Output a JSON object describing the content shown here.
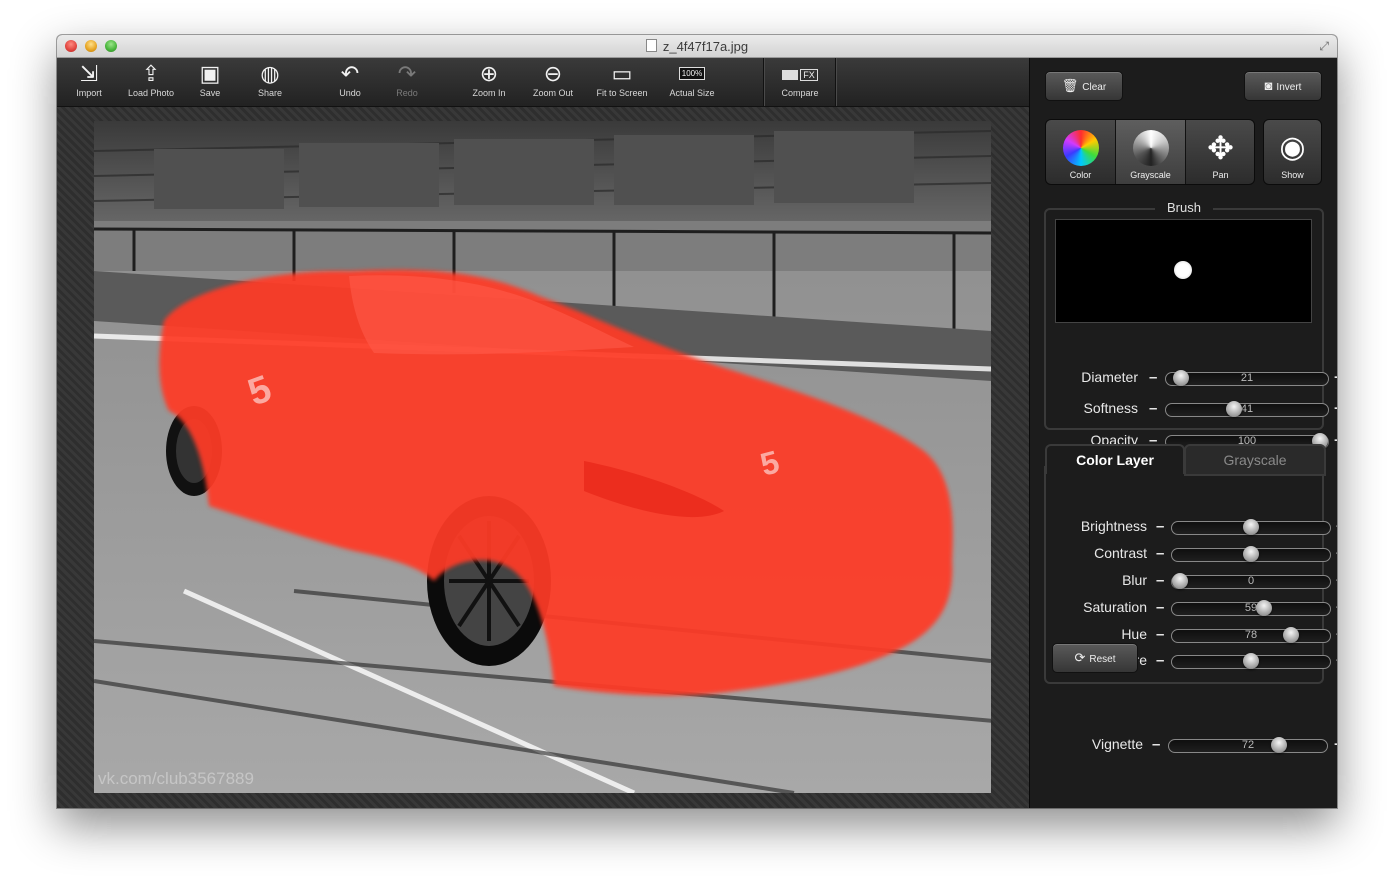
{
  "window": {
    "title": "z_4f47f17a.jpg"
  },
  "toolbar": {
    "import": "Import",
    "load_photo": "Load Photo",
    "save": "Save",
    "share": "Share",
    "undo": "Undo",
    "redo": "Redo",
    "zoom_in": "Zoom In",
    "zoom_out": "Zoom Out",
    "fit_to_screen": "Fit to Screen",
    "actual_size": "Actual Size",
    "actual_size_badge": "100%",
    "compare": "Compare",
    "compare_badge": "FX"
  },
  "canvas": {
    "watermark": "vk.com/club3567889"
  },
  "sidebar": {
    "clear": "Clear",
    "invert": "Invert",
    "modes": {
      "color": "Color",
      "grayscale": "Grayscale",
      "pan": "Pan",
      "show": "Show"
    },
    "brush": {
      "title": "Brush",
      "diameter": {
        "label": "Diameter",
        "value": 21,
        "fraction": 0.05
      },
      "softness": {
        "label": "Softness",
        "value": 41,
        "fraction": 0.41
      },
      "opacity": {
        "label": "Opacity",
        "value": 100,
        "fraction": 1.0
      }
    },
    "tabs": {
      "color_layer": "Color Layer",
      "grayscale": "Grayscale"
    },
    "adjust": {
      "brightness": {
        "label": "Brightness",
        "value": 50,
        "fraction": 0.5
      },
      "contrast": {
        "label": "Contrast",
        "value": 50,
        "fraction": 0.5
      },
      "blur": {
        "label": "Blur",
        "value": 0,
        "fraction": 0.0
      },
      "saturation": {
        "label": "Saturation",
        "value": 59,
        "fraction": 0.59
      },
      "hue": {
        "label": "Hue",
        "value": 78,
        "fraction": 0.78
      },
      "exposure": {
        "label": "Exposure",
        "value": 50,
        "fraction": 0.5
      }
    },
    "reset": "Reset",
    "vignette": {
      "label": "Vignette",
      "value": 72,
      "fraction": 0.72
    },
    "minus": "–",
    "plus": "+"
  }
}
